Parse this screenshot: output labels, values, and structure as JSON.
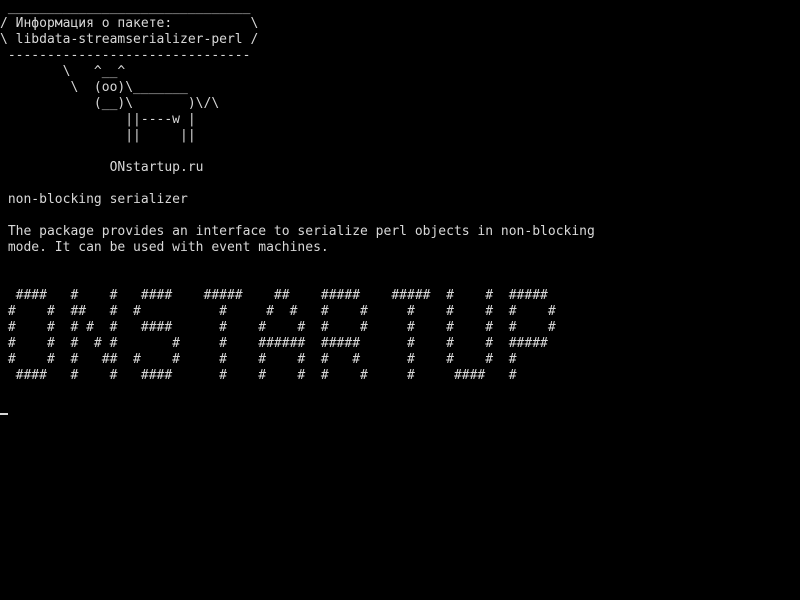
{
  "terminal": {
    "cowsay": {
      "bubble_top": " _______________________________",
      "bubble_line1": "/ Информация о пакете:          \\",
      "bubble_line2": "\\ libdata-streamserializer-perl /",
      "bubble_bottom": " -------------------------------",
      "cow_line1": "        \\   ^__^",
      "cow_line2": "         \\  (oo)\\_______",
      "cow_line3": "            (__)\\       )\\/\\",
      "cow_line4": "                ||----w |",
      "cow_line5": "                ||     ||"
    },
    "site_line": "              ONstartup.ru",
    "summary": " non-blocking serializer",
    "description_line1": " The package provides an interface to serialize perl objects in non-blocking",
    "description_line2": " mode. It can be used with event machines.",
    "banner": {
      "line1": "  ####   #    #   ####    #####    ##    #####    #####  #    #  #####",
      "line2": " #    #  ##   #  #          #     #  #   #    #     #    #    #  #    #",
      "line3": " #    #  # #  #   ####      #    #    #  #    #     #    #    #  #    #",
      "line4": " #    #  #  # #       #     #    ######  #####      #    #    #  #####",
      "line5": " #    #  #   ##  #    #     #    #    #  #   #      #    #    #  #",
      "line6": "  ####   #    #   ####      #    #    #  #    #     #     ####   #"
    }
  }
}
